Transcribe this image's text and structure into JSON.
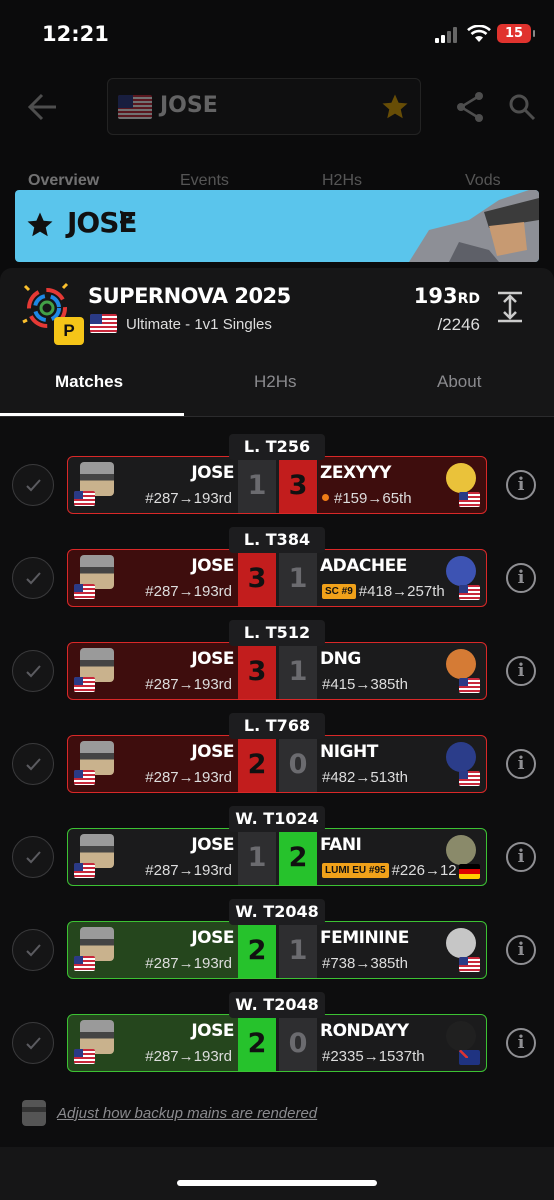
{
  "status": {
    "time": "12:21",
    "battery": "15"
  },
  "header": {
    "player_name": "JOSE",
    "tabs": [
      "Overview",
      "Events",
      "H2Hs",
      "Vods"
    ]
  },
  "banner": {
    "title": "JOSE",
    "chevron": ">"
  },
  "event": {
    "title": "SUPERNOVA 2025",
    "subtitle": "Ultimate - 1v1 Singles",
    "badge_letter": "P",
    "placement": "193",
    "placement_suffix": "RD",
    "entrants": "/2246"
  },
  "subtabs": [
    "Matches",
    "H2Hs",
    "About"
  ],
  "colors": {
    "loss": "#d92828",
    "win": "#3cc233",
    "banner": "#5ac5ec"
  },
  "matches": [
    {
      "round": "L. T256",
      "player": "JOSE",
      "player_seed": "#287→193rd",
      "score_player": "1",
      "score_opponent": "3",
      "opponent": "ZEXYYY",
      "opponent_seed": "#159→65th",
      "opponent_badge": "",
      "result": "loss"
    },
    {
      "round": "L. T384",
      "player": "JOSE",
      "player_seed": "#287→193rd",
      "score_player": "3",
      "score_opponent": "1",
      "opponent": "ADACHEE",
      "opponent_seed": "#418→257th",
      "opponent_badge": "SC #9",
      "result": "win"
    },
    {
      "round": "L. T512",
      "player": "JOSE",
      "player_seed": "#287→193rd",
      "score_player": "3",
      "score_opponent": "1",
      "opponent": "DNG",
      "opponent_seed": "#415→385th",
      "opponent_badge": "",
      "result": "win"
    },
    {
      "round": "L. T768",
      "player": "JOSE",
      "player_seed": "#287→193rd",
      "score_player": "2",
      "score_opponent": "0",
      "opponent": "NIGHT",
      "opponent_seed": "#482→513th",
      "opponent_badge": "",
      "result": "win"
    },
    {
      "round": "W. T1024",
      "player": "JOSE",
      "player_seed": "#287→193rd",
      "score_player": "1",
      "score_opponent": "2",
      "opponent": "FANI",
      "opponent_seed": "#226→12",
      "opponent_badge": "LUMI EU #95",
      "result": "loss"
    },
    {
      "round": "W. T2048",
      "player": "JOSE",
      "player_seed": "#287→193rd",
      "score_player": "2",
      "score_opponent": "1",
      "opponent": "FEMININE",
      "opponent_seed": "#738→385th",
      "opponent_badge": "",
      "result": "win"
    },
    {
      "round": "W. T2048",
      "player": "JOSE",
      "player_seed": "#287→193rd",
      "score_player": "2",
      "score_opponent": "0",
      "opponent": "RONDAYY",
      "opponent_seed": "#2335→1537th",
      "opponent_badge": "",
      "result": "win"
    }
  ],
  "footer": {
    "link": "Adjust how backup mains are rendered"
  }
}
